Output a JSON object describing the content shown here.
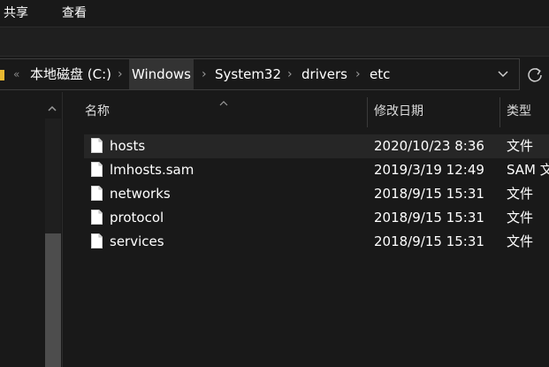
{
  "ribbon": {
    "tabs": [
      {
        "label": "共享"
      },
      {
        "label": "查看"
      }
    ]
  },
  "address_bar": {
    "overflow": "«",
    "crumbs": [
      {
        "label": "本地磁盘 (C:)"
      },
      {
        "label": "Windows"
      },
      {
        "label": "System32"
      },
      {
        "label": "drivers"
      },
      {
        "label": "etc"
      }
    ],
    "separator": "›"
  },
  "file_list": {
    "columns": {
      "name": "名称",
      "date": "修改日期",
      "type": "类型"
    },
    "rows": [
      {
        "name": "hosts",
        "date": "2020/10/23 8:36",
        "type": "文件"
      },
      {
        "name": "lmhosts.sam",
        "date": "2019/3/19 12:49",
        "type": "SAM 文"
      },
      {
        "name": "networks",
        "date": "2018/9/15 15:31",
        "type": "文件"
      },
      {
        "name": "protocol",
        "date": "2018/9/15 15:31",
        "type": "文件"
      },
      {
        "name": "services",
        "date": "2018/9/15 15:31",
        "type": "文件"
      }
    ]
  },
  "icons": {
    "file": "file-icon",
    "folder": "folder-icon",
    "dropdown": "chevron-down-icon",
    "refresh": "refresh-icon",
    "scroll_up": "chevron-up-icon",
    "sort": "sort-ascending-icon"
  },
  "colors": {
    "background": "#191919",
    "selected_row": "#262626",
    "folder_yellow": "#e8b830",
    "text": "#ffffff"
  }
}
